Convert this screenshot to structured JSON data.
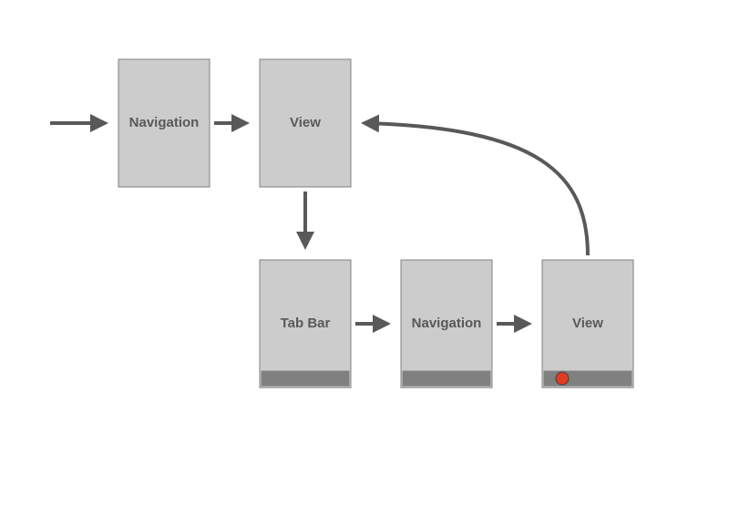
{
  "diagram": {
    "nodes": {
      "nav1": {
        "label": "Navigation"
      },
      "view1": {
        "label": "View"
      },
      "tabbar": {
        "label": "Tab Bar"
      },
      "nav2": {
        "label": "Navigation"
      },
      "view2": {
        "label": "View"
      }
    }
  }
}
